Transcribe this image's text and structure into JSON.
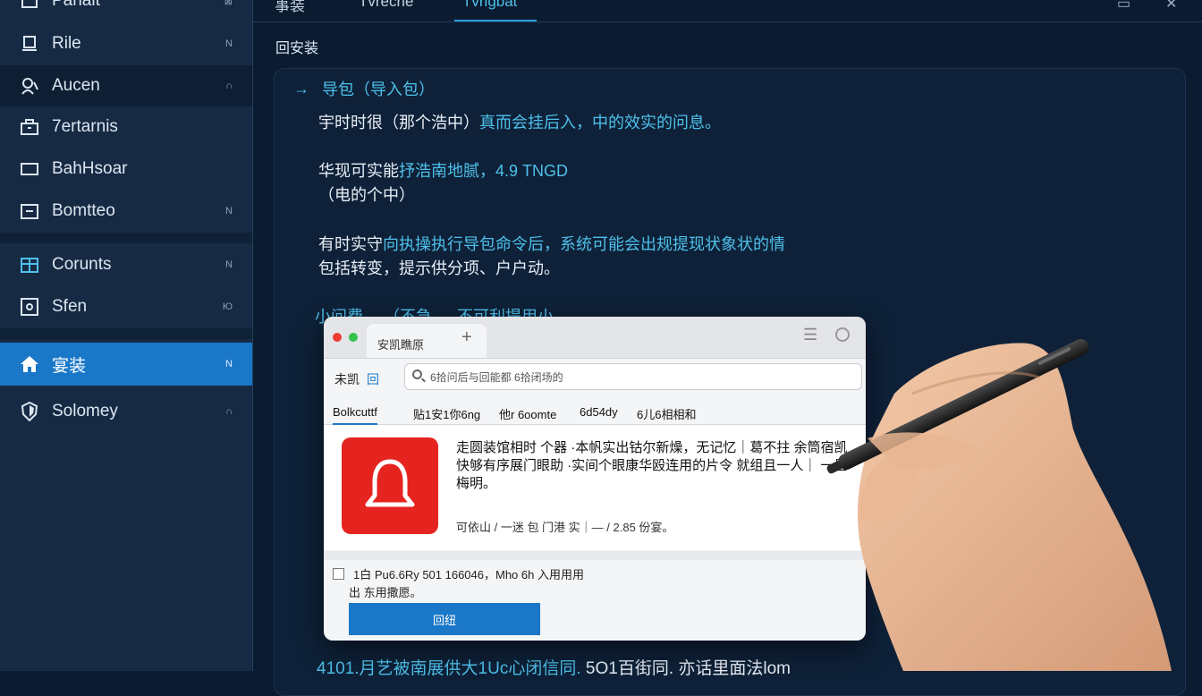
{
  "sidebar": {
    "items": [
      {
        "label": "Pariait",
        "badge": "⊠",
        "icon": "folder-icon"
      },
      {
        "label": "Rile",
        "badge": "N",
        "icon": "document-icon"
      },
      {
        "label": "Aucen",
        "badge": "∩",
        "icon": "user-icon"
      },
      {
        "label": "7ertarnis",
        "badge": "",
        "icon": "briefcase-icon"
      },
      {
        "label": "BahHsoar",
        "badge": "",
        "icon": "window-icon"
      },
      {
        "label": "Bomtteo",
        "badge": "N",
        "icon": "box-icon"
      },
      {
        "label": "Corunts",
        "badge": "N",
        "icon": "calendar-icon"
      },
      {
        "label": "Sfen",
        "badge": "Ю",
        "icon": "settings-icon"
      },
      {
        "label": "宴装",
        "badge": "N",
        "icon": "home-icon"
      },
      {
        "label": "Solomey",
        "badge": "∩",
        "icon": "shield-icon"
      }
    ]
  },
  "topbar": {
    "tabs": [
      "事装",
      "Tvrecrie",
      "Tvrigbat"
    ],
    "active_tab": 2
  },
  "section_title": "回安装",
  "content": {
    "package_row": "导包（导入包）",
    "para1": {
      "a": "宇时时很（那个浩中）",
      "b": "真而会挂后入，中的效实的问息。"
    },
    "para2": {
      "a": "华现可实能",
      "b": "抒浩南地腻，4.9 TNGD"
    },
    "para2b": "（电的个中）",
    "para3": {
      "a": "有时实守",
      "b": "向执操执行导包命令后，系统可能会出规提现状象状的情",
      "c": "包括转变，提示供分项、户户动。"
    },
    "frag_row": "小问费  →（不急  →  不可利提用小",
    "bottom_line": {
      "a": "4101.月艺被南展供大1Uc心闭信同.",
      "b": "5O1百街同.",
      "c": "亦话里面法lom"
    }
  },
  "dialog": {
    "tab_title": "安凯瞧原",
    "address_label": "未凯",
    "address_label_b": "回",
    "address_value": "6拾问后与回能都 6拾闭场的",
    "tabs": [
      "Bolkcuttf",
      "贴1安1你6ng",
      "他r 6oomte",
      "6d54dy",
      "6儿6相相和"
    ],
    "notice_text": "走圆装馆相时 个器 ·本帆实出钴尔新燥，无记忆｜葛不拄 余筒宿凯快够有序展门眼助 ·实间个眼康华殴连用的片令 就组且一人｜ 一星梅明。",
    "notice_sub": "可依山 / 一迷 包 门港 实｜— / 2.85 份宴。",
    "checkbox_label": "1白 Pu6.6Ry 501 166046，Mho 6h 入用用用",
    "checkbox_sub": "出 东用撒愿。",
    "confirm_label": "回纽"
  },
  "colors": {
    "accent": "#1b78c8",
    "highlight": "#4ec0ea",
    "alert": "#e52420"
  }
}
